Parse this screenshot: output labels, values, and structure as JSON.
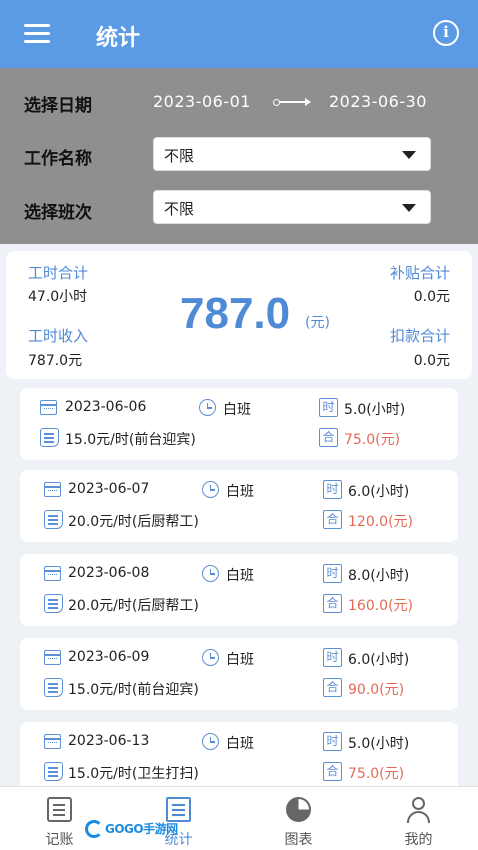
{
  "header": {
    "title": "统计",
    "menu_icon": "menu-icon",
    "info_icon": "info-icon"
  },
  "filter": {
    "date_label": "选择日期",
    "start_date": "2023-06-01",
    "end_date": "2023-06-30",
    "job_label": "工作名称",
    "job_value": "不限",
    "shift_label": "选择班次",
    "shift_value": "不限"
  },
  "summary": {
    "hours_label": "工时合计",
    "hours_value": "47.0小时",
    "income_label": "工时收入",
    "income_value": "787.0元",
    "total": "787.0",
    "total_unit": "(元)",
    "subsidy_label": "补贴合计",
    "subsidy_value": "0.0元",
    "deduction_label": "扣款合计",
    "deduction_value": "0.0元"
  },
  "records": [
    {
      "date": "2023-06-06",
      "shift": "白班",
      "hours": "5.0(小时)",
      "rate": "15.0元/时(前台迎宾)",
      "amount": "75.0(元)"
    },
    {
      "date": "2023-06-07",
      "shift": "白班",
      "hours": "6.0(小时)",
      "rate": "20.0元/时(后厨帮工)",
      "amount": "120.0(元)"
    },
    {
      "date": "2023-06-08",
      "shift": "白班",
      "hours": "8.0(小时)",
      "rate": "20.0元/时(后厨帮工)",
      "amount": "160.0(元)"
    },
    {
      "date": "2023-06-09",
      "shift": "白班",
      "hours": "6.0(小时)",
      "rate": "15.0元/时(前台迎宾)",
      "amount": "90.0(元)"
    },
    {
      "date": "2023-06-13",
      "shift": "白班",
      "hours": "5.0(小时)",
      "rate": "15.0元/时(卫生打扫)",
      "amount": "75.0(元)"
    }
  ],
  "record_glyphs": {
    "hours": "时",
    "amount": "合"
  },
  "tabs": [
    {
      "label": "记账",
      "icon": "edit-icon"
    },
    {
      "label": "统计",
      "icon": "list-icon"
    },
    {
      "label": "图表",
      "icon": "pie-chart-icon"
    },
    {
      "label": "我的",
      "icon": "user-icon"
    }
  ],
  "watermark": {
    "text": "GOGO手游网"
  },
  "colors": {
    "primary": "#5b9be6",
    "accent_text": "#4f8ad6",
    "amount_red": "#e36a55",
    "filter_bg": "#8f8f8f"
  }
}
